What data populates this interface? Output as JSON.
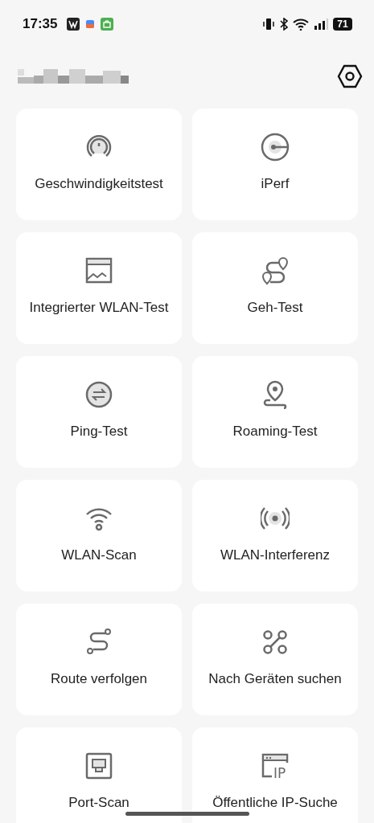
{
  "status_bar": {
    "time": "17:35",
    "battery": "71"
  },
  "tools": [
    {
      "kind": "speed",
      "label": "Geschwindigkeitstest"
    },
    {
      "kind": "iperf",
      "label": "iPerf"
    },
    {
      "kind": "chart",
      "label": "Integrierter WLAN-Test"
    },
    {
      "kind": "walk",
      "label": "Geh-Test"
    },
    {
      "kind": "ping",
      "label": "Ping-Test"
    },
    {
      "kind": "roaming",
      "label": "Roaming-Test"
    },
    {
      "kind": "wifi",
      "label": "WLAN-Scan"
    },
    {
      "kind": "interference",
      "label": "WLAN-Interferenz"
    },
    {
      "kind": "route",
      "label": "Route verfolgen"
    },
    {
      "kind": "devices",
      "label": "Nach Geräten suchen"
    },
    {
      "kind": "port",
      "label": "Port-Scan"
    },
    {
      "kind": "ip",
      "label": "Öffentliche IP-Suche"
    }
  ],
  "ip_icon_text": "IP"
}
